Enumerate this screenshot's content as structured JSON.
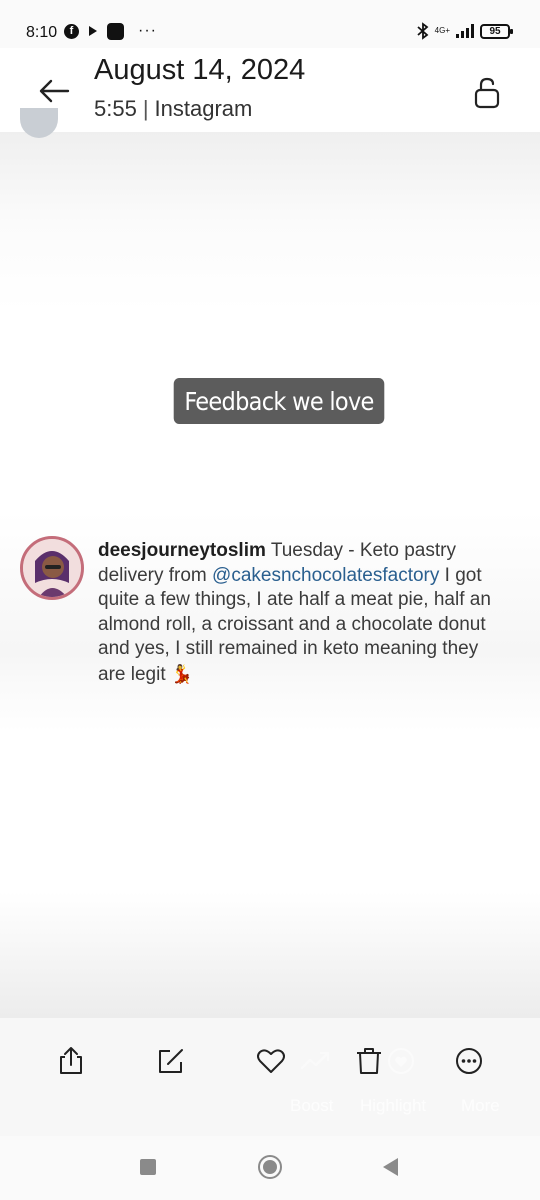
{
  "status_bar": {
    "time": "8:10",
    "network": "4G+",
    "battery": "95"
  },
  "header": {
    "date": "August 14, 2024",
    "time": "5:55",
    "source": "Instagram"
  },
  "photo": {
    "caption": "Feedback we love",
    "comment": {
      "username": "deesjourneytoslim",
      "text_1": " Tuesday - Keto pastry delivery from ",
      "mention": "@cakesnchocolatesfactory",
      "text_2": " I got quite a few things, I ate half a meat pie, half an almond roll, a croissant and a chocolate donut and yes, I still remained in keto meaning they are legit ",
      "emoji": "💃"
    }
  },
  "actions": {
    "items": [
      "share-icon",
      "edit-icon",
      "heart-icon",
      "trash-icon",
      "more-icon"
    ],
    "faded_labels": {
      "boost": "Boost",
      "highlight": "Highlight",
      "more": "More"
    }
  },
  "colors": {
    "caption_bg": "#5c5c5c",
    "mention": "#2a5f8f",
    "avatar_ring": "#c46d7a"
  }
}
